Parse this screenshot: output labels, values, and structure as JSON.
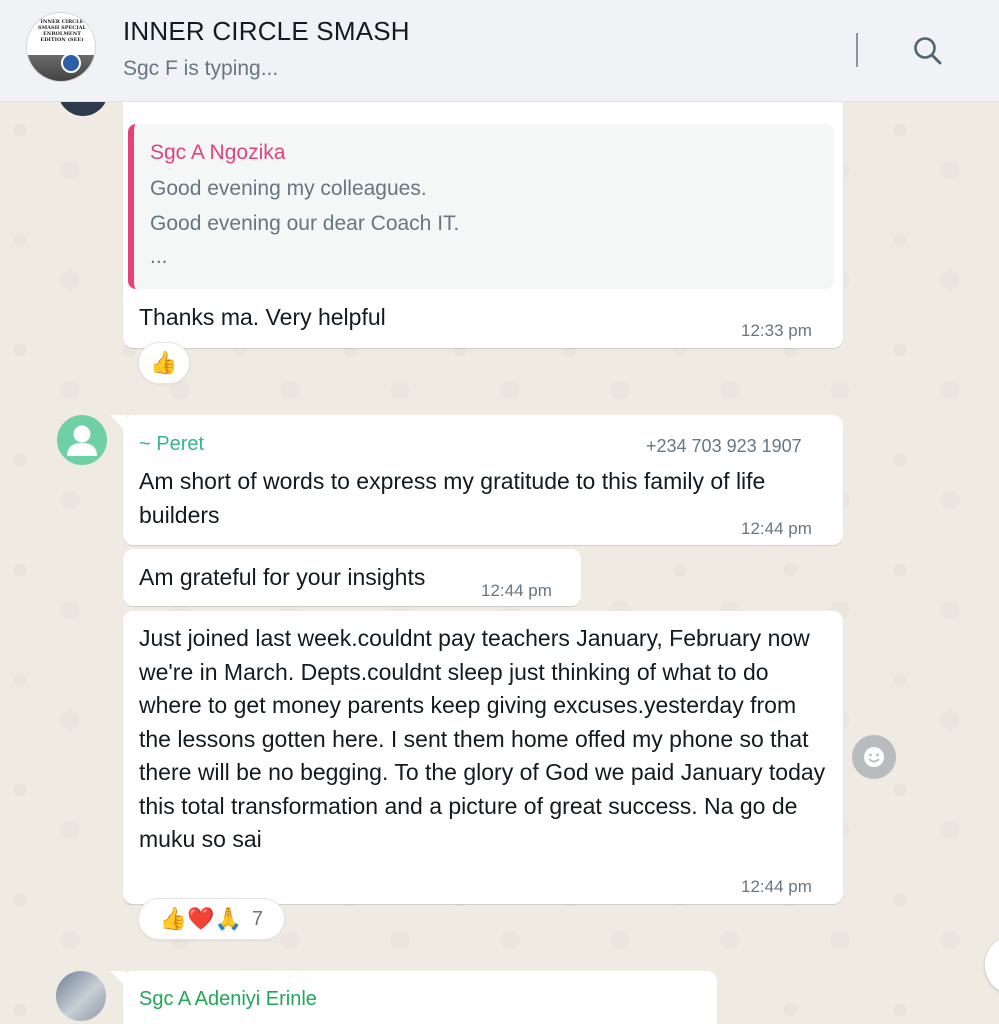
{
  "header": {
    "title": "INNER CIRCLE SMASH",
    "status": "Sgc F is typing...",
    "avatar_text": "INNER CIRCLE SMASH SPECIAL ENROLMENT EDITION (SEE)"
  },
  "messages": {
    "reply": {
      "quoted_author": "Sgc A Ngozika",
      "quoted_lines": [
        "Good evening my colleagues.",
        "Good evening our dear Coach IT.",
        "..."
      ],
      "text": "Thanks ma. Very helpful",
      "time": "12:33 pm",
      "reactions": "👍"
    },
    "peret": {
      "sender": "~ Peret",
      "phone": "+234 703 923 1907",
      "msg1": "Am short of words to express my gratitude to this family of life builders",
      "time1": "12:44 pm",
      "msg2": "Am grateful for your insights",
      "time2": "12:44 pm",
      "msg3": "Just joined last week.couldnt pay teachers January, February now we're in March. Depts.couldnt sleep just thinking of what to do where to get money parents keep giving excuses.yesterday from the lessons gotten here. I sent them home offed my phone so that there will be no begging. To the glory of God we paid January today this total transformation and a picture of great success. Na go de muku so sai",
      "time3": "12:44 pm",
      "reactions": {
        "emojis": "👍❤️🙏",
        "count": "7"
      }
    },
    "next": {
      "sender": "Sgc A Adeniyi Erinle"
    }
  },
  "colors": {
    "quote_accent": "#e5417a",
    "peret_name": "#35b58b",
    "adeniyi_name": "#1fa855",
    "chat_bg": "#efeae2"
  }
}
